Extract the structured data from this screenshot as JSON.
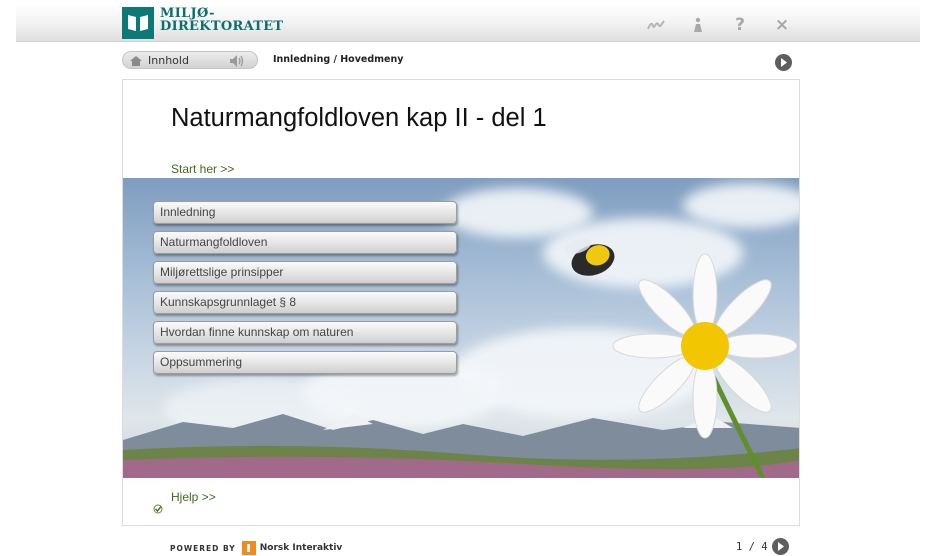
{
  "header": {
    "logo_line1": "MILJØ-",
    "logo_line2": "DIREKTORATET",
    "icons": [
      "sign-icon",
      "info-icon",
      "help-icon",
      "close-icon"
    ],
    "help_glyph": "?",
    "close_glyph": "×"
  },
  "nav": {
    "contents_label": "Innhold",
    "breadcrumb": "Innledning / Hovedmeny"
  },
  "content": {
    "title": "Naturmangfoldloven kap II - del 1",
    "start_link": "Start her  >>",
    "menu": [
      "Innledning",
      "Naturmangfoldloven",
      "Miljørettslige prinsipper",
      "Kunnskapsgrunnlaget § 8",
      "Hvordan finne kunnskap om naturen",
      "Oppsummering"
    ],
    "help_link": "Hjelp >>"
  },
  "footer": {
    "powered_by": "POWERED BY",
    "vendor": "Norsk Interaktiv",
    "page_indicator": "1 / 4"
  },
  "colors": {
    "brand_teal": "#0b7a77",
    "link_green": "#3d6b1c",
    "button_gray": "#5e5e5e",
    "vendor_orange": "#f28a1f"
  }
}
